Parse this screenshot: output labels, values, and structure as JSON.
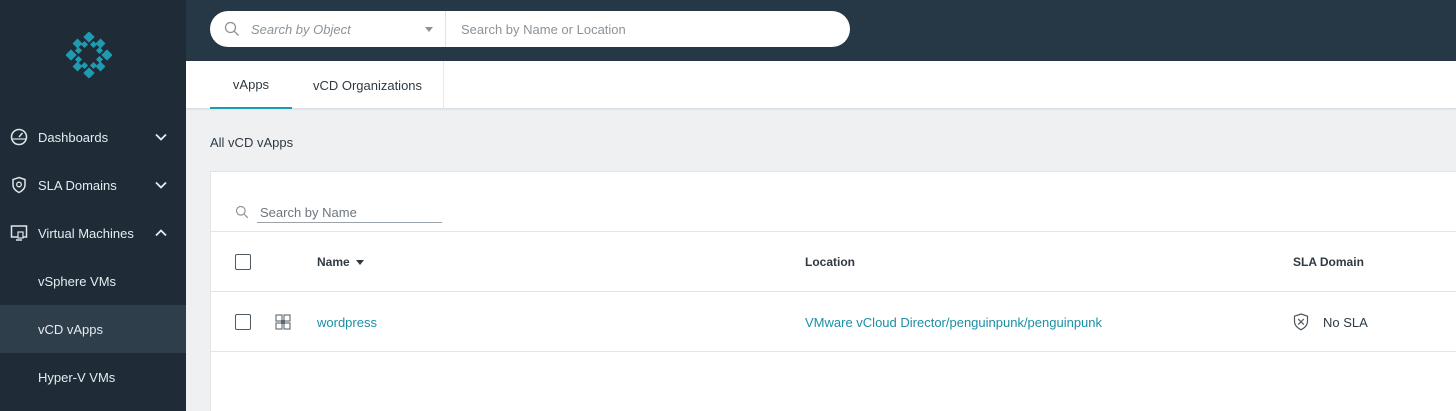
{
  "app": {
    "accent_color": "#1e9bb0",
    "sidebar_color": "#1f2c37"
  },
  "sidebar": {
    "logo_icon": "rubrik-logo",
    "items": [
      {
        "label": "Dashboards",
        "icon": "dashboard-gauge-icon",
        "expanded": false
      },
      {
        "label": "SLA Domains",
        "icon": "shield-icon",
        "expanded": false
      },
      {
        "label": "Virtual Machines",
        "icon": "vm-monitor-icon",
        "expanded": true
      }
    ],
    "subitems": [
      {
        "label": "vSphere VMs"
      },
      {
        "label": "vCD vApps",
        "active": true
      },
      {
        "label": "Hyper-V VMs"
      }
    ]
  },
  "topbar": {
    "object_search_placeholder": "Search by Object",
    "name_search_placeholder": "Search by Name or Location"
  },
  "tabs": [
    {
      "label": "vApps",
      "active": true
    },
    {
      "label": "vCD Organizations",
      "active": false
    }
  ],
  "main": {
    "section_title": "All vCD vApps",
    "search_placeholder": "Search by Name",
    "table": {
      "columns": [
        "Name",
        "Location",
        "SLA Domain"
      ],
      "sort_column": "Name",
      "rows": [
        {
          "name": "wordpress",
          "icon": "vapp-grid-icon",
          "location": "VMware vCloud Director/penguinpunk/penguinpunk",
          "sla_icon": "no-sla-shield-icon",
          "sla_domain": "No SLA"
        }
      ]
    }
  }
}
